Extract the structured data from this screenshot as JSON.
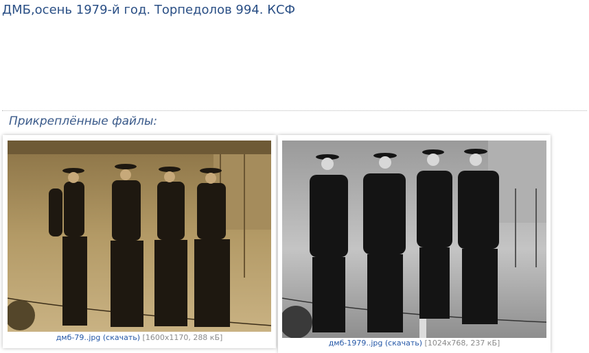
{
  "post": {
    "title": "ДМБ,осень 1979-й год. Торпедолов 994. КСФ"
  },
  "attachments": {
    "heading": "Прикреплённые файлы:",
    "files": [
      {
        "filename": "дмб-79..jpg",
        "download_label": "(скачать)",
        "meta": "[1600x1170, 288 кБ]",
        "image_desc_icon": "photo-sepia-sailors-icon"
      },
      {
        "filename": "дмб-1979..jpg",
        "download_label": "(скачать)",
        "meta": "[1024x768, 237 кБ]",
        "image_desc_icon": "photo-bw-sailors-icon"
      }
    ]
  },
  "colors": {
    "title": "#2a4f85",
    "link": "#2457a7",
    "meta": "#8a8a8a",
    "sepia_bg": "#a98f5c",
    "bw_bg": "#b8b8b8"
  }
}
